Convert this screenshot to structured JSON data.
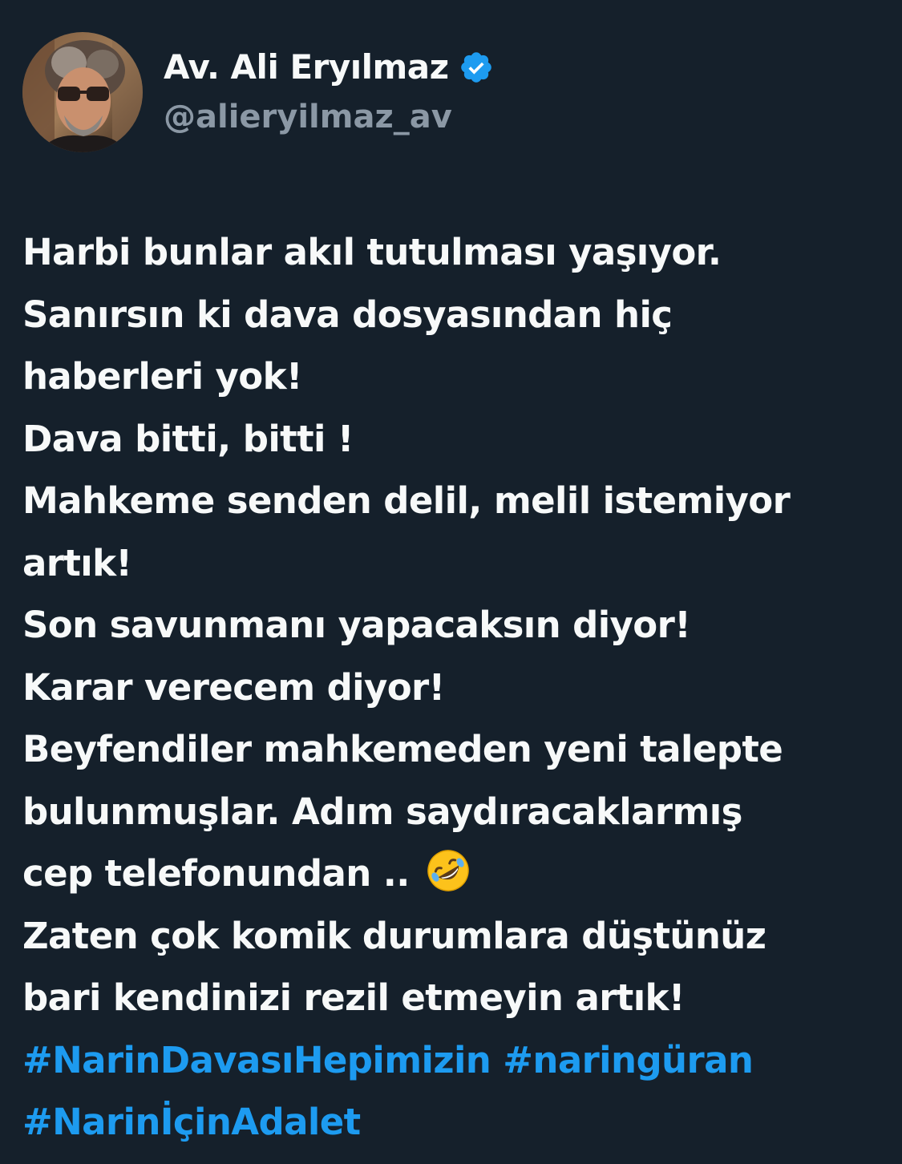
{
  "author": {
    "display_name": "Av. Ali Eryılmaz",
    "handle": "@alieryilmaz_av",
    "verified_icon": "verified-badge-icon",
    "verified_color": "#1d9bf0",
    "avatar": "profile-photo"
  },
  "tweet": {
    "lines": [
      "Harbi bunlar akıl tutulması yaşıyor.",
      "Sanırsın ki dava dosyasından hiç",
      "haberleri yok!",
      "Dava bitti, bitti !",
      "Mahkeme senden delil, melil istemiyor",
      "artık!",
      "Son savunmanı yapacaksın diyor!",
      "Karar verecem diyor!",
      "Beyfendiler mahkemeden yeni talepte",
      "bulunmuşlar. Adım saydıracaklarmış",
      "cep telefonundan .. ",
      "Zaten çok komik durumlara düştünüz",
      "bari kendinizi rezil etmeyin artık!"
    ],
    "emoji": "rolling-on-the-floor-laughing-emoji",
    "hashtags": [
      "#NarinDavasıHepimizin",
      "#naringüran",
      "#Narinİçin­Adalet"
    ],
    "text_color": "#f7f9f9",
    "hashtag_color": "#1d9bf0"
  },
  "theme": {
    "background": "#15202b"
  }
}
